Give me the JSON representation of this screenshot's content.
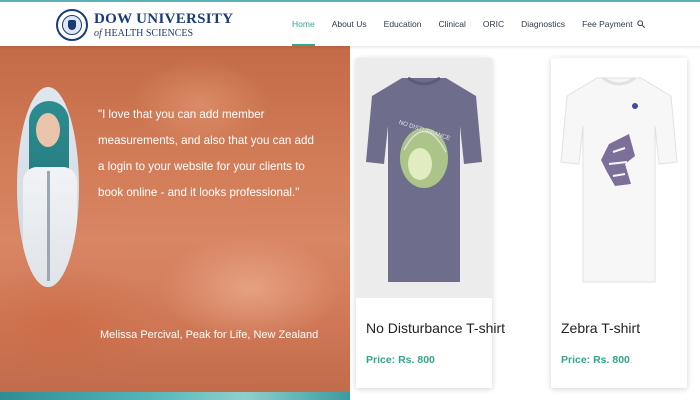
{
  "brand": {
    "line1": "DOW UNIVERSITY",
    "line2_of": "of",
    "line2": "HEALTH SCIENCES"
  },
  "nav": {
    "items": [
      "Home",
      "About Us",
      "Education",
      "Clinical",
      "ORIC",
      "Diagnostics",
      "Fee Payment"
    ],
    "active": "Home",
    "search_icon": "search-icon"
  },
  "testimonial": {
    "quote": "\"I love that you can add member measurements, and also that you can add a login to your website for your clients to book online - and it looks professional.\"",
    "author": "Melissa Percival, Peak for Life, New Zealand"
  },
  "products": [
    {
      "name": "No Disturbance T-shirt",
      "price": "Price: Rs. 800",
      "shirt_color": "#6f6d8c"
    },
    {
      "name": "Zebra T-shirt",
      "price": "Price: Rs. 800",
      "shirt_color": "#f7f7f7"
    }
  ],
  "colors": {
    "accent": "#36a58f",
    "brand_blue": "#1b3a7a",
    "nav_text": "#2f3b4a"
  }
}
